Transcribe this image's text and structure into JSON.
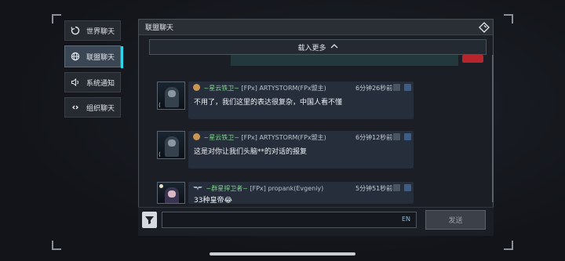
{
  "nav": {
    "items": [
      {
        "label": "世界聊天",
        "icon": "world-refresh-icon"
      },
      {
        "label": "联盟聊天",
        "icon": "globe-icon"
      },
      {
        "label": "系统通知",
        "icon": "speaker-icon"
      },
      {
        "label": "组织聊天",
        "icon": "link-icon"
      }
    ],
    "active_index": 1
  },
  "panel": {
    "title": "联盟聊天",
    "header_icon": "diamond-icon",
    "load_more": "载入更多",
    "load_more_icon": "chevron-up-icon"
  },
  "messages": [
    {
      "guild": "~星云铁卫~",
      "tag": "[FPx]",
      "name": "ARTYSTORM(FPx盟主)",
      "time": "6分钟26秒前",
      "text": "不用了，我们这里的表达很复杂，中国人看不懂",
      "avatar": "commander"
    },
    {
      "guild": "~星云铁卫~",
      "tag": "[FPx]",
      "name": "ARTYSTORM(FPx盟主)",
      "time": "6分钟12秒前",
      "text": "这是对你让我们头脑**的对话的报复",
      "avatar": "commander"
    },
    {
      "guild": "~群星捍卫者~",
      "tag": "[FPx]",
      "name": "propank(Evgeniy)",
      "time": "5分钟51秒前",
      "text": "33种皇帝😂",
      "avatar": "pilot"
    }
  ],
  "input": {
    "value": "",
    "lang": "EN",
    "send_label": "发送"
  },
  "colors": {
    "accent": "#2fd4e6",
    "guild_name": "#7ed48a",
    "alert": "#b8242c"
  }
}
